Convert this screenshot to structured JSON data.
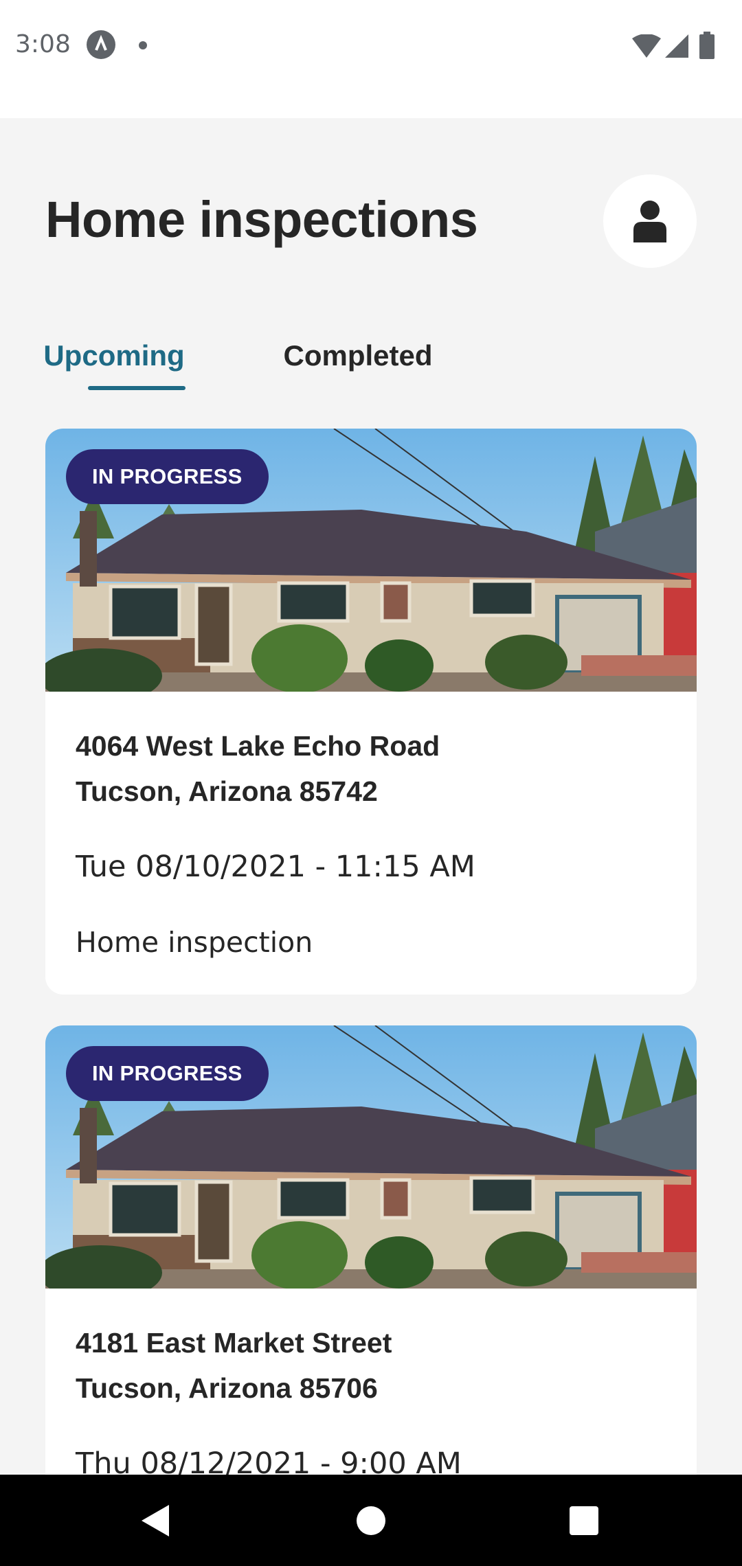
{
  "status_bar": {
    "time": "3:08",
    "icons": [
      "app-notification-icon",
      "dot-icon",
      "wifi-icon",
      "cell-signal-icon",
      "battery-icon"
    ]
  },
  "header": {
    "title": "Home inspections",
    "profile_icon": "person-icon"
  },
  "tabs": [
    {
      "label": "Upcoming",
      "selected": true
    },
    {
      "label": "Completed",
      "selected": false
    }
  ],
  "inspections": [
    {
      "status": "IN PROGRESS",
      "address_line1": "4064 West Lake Echo Road",
      "address_line2": "Tucson, Arizona 85742",
      "datetime": "Tue 08/10/2021 - 11:15 AM",
      "type": "Home inspection"
    },
    {
      "status": "IN PROGRESS",
      "address_line1": "4181 East Market Street",
      "address_line2": "Tucson, Arizona 85706",
      "datetime": "Thu 08/12/2021 - 9:00 AM",
      "type": ""
    }
  ],
  "colors": {
    "accent": "#1e6a85",
    "badge": "#2b2670",
    "title": "#262626",
    "background": "#f4f4f4"
  },
  "nav_bar": [
    "back-icon",
    "home-icon",
    "recents-icon"
  ]
}
